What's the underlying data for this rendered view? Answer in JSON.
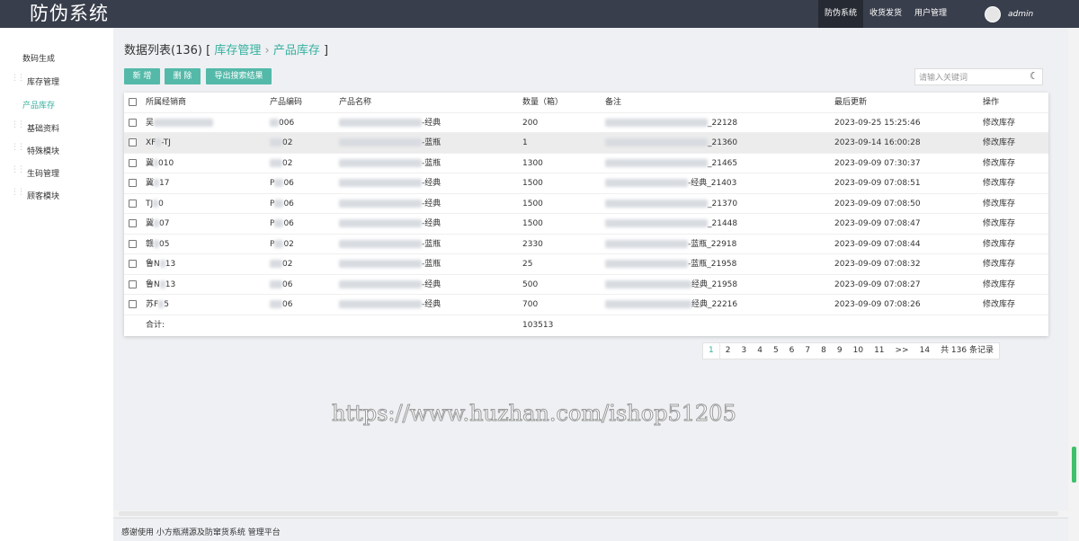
{
  "app": {
    "title": "防伪系统"
  },
  "topnav": [
    {
      "label": "防伪系统",
      "active": true
    },
    {
      "label": "收货发货",
      "active": false
    },
    {
      "label": "用户管理",
      "active": false
    }
  ],
  "user": {
    "name": "admin"
  },
  "sidebar": {
    "items": [
      {
        "label": "数码生成",
        "active": false,
        "grip": false
      },
      {
        "label": "库存管理",
        "active": false,
        "grip": true
      },
      {
        "label": "产品库存",
        "active": true,
        "grip": false
      },
      {
        "label": "基础资料",
        "active": false,
        "grip": true
      },
      {
        "label": "特殊模块",
        "active": false,
        "grip": true
      },
      {
        "label": "生码管理",
        "active": false,
        "grip": true
      },
      {
        "label": "顾客模块",
        "active": false,
        "grip": true
      }
    ]
  },
  "page": {
    "title": "数据列表(136)",
    "bracket_open": "[",
    "bracket_close": "]",
    "breadcrumb": [
      "库存管理",
      "产品库存"
    ],
    "separator": "›"
  },
  "toolbar": {
    "add_label": "新 增",
    "delete_label": "删 除",
    "export_label": "导出搜索结果"
  },
  "search": {
    "placeholder": "请输入关键词",
    "icon": "refresh-search-icon"
  },
  "table": {
    "headers": [
      "所属经销商",
      "产品编码",
      "产品名称",
      "数量（箱）",
      "备注",
      "最后更新",
      "操作"
    ],
    "rows": [
      {
        "dealer": "吴",
        "code": "0",
        "code_suffix": "06",
        "name": "-经典",
        "qty": "200",
        "note": "_22128",
        "updated": "2023-09-25 15:25:46",
        "action": "修改库存"
      },
      {
        "dealer": "XF",
        "dealer_suffix": "-TJ",
        "code": "",
        "code_suffix": "02",
        "name": "-蓝瓶",
        "qty": "1",
        "note": "_21360",
        "updated": "2023-09-14 16:00:28",
        "action": "修改库存"
      },
      {
        "dealer": "冀",
        "dealer_suffix": "010",
        "code": "",
        "code_suffix": "02",
        "name": "-蓝瓶",
        "qty": "1300",
        "note": "_21465",
        "updated": "2023-09-09 07:30:37",
        "action": "修改库存"
      },
      {
        "dealer": "冀",
        "dealer_suffix": "17",
        "code": "P",
        "code_suffix": "06",
        "name": "-经典",
        "qty": "1500",
        "note": "-经典_21403",
        "updated": "2023-09-09 07:08:51",
        "action": "修改库存"
      },
      {
        "dealer": "TJ",
        "dealer_suffix": "0",
        "code": "P",
        "code_suffix": "06",
        "name": "-经典",
        "qty": "1500",
        "note": "_21370",
        "updated": "2023-09-09 07:08:50",
        "action": "修改库存"
      },
      {
        "dealer": "冀",
        "dealer_suffix": "07",
        "code": "P",
        "code_suffix": "06",
        "name": "-经典",
        "qty": "1500",
        "note": "_21448",
        "updated": "2023-09-09 07:08:47",
        "action": "修改库存"
      },
      {
        "dealer": "赣",
        "dealer_suffix": "05",
        "code": "P",
        "code_suffix": "02",
        "name": "-蓝瓶",
        "qty": "2330",
        "note": "-蓝瓶_22918",
        "updated": "2023-09-09 07:08:44",
        "action": "修改库存"
      },
      {
        "dealer": "鲁N",
        "dealer_suffix": "13",
        "code": "",
        "code_suffix": "02",
        "name": "-蓝瓶",
        "qty": "25",
        "note": "-蓝瓶_21958",
        "updated": "2023-09-09 07:08:32",
        "action": "修改库存"
      },
      {
        "dealer": "鲁N",
        "dealer_suffix": "13",
        "code": "",
        "code_suffix": "06",
        "name": "-经典",
        "qty": "500",
        "note": "经典_21958",
        "updated": "2023-09-09 07:08:27",
        "action": "修改库存"
      },
      {
        "dealer": "苏F",
        "dealer_suffix": "5",
        "code": "",
        "code_suffix": "06",
        "name": "-经典",
        "qty": "700",
        "note": "经典_22216",
        "updated": "2023-09-09 07:08:26",
        "action": "修改库存"
      }
    ],
    "total_label": "合计:",
    "total_qty": "103513"
  },
  "pagination": {
    "pages": [
      "1",
      "2",
      "3",
      "4",
      "5",
      "6",
      "7",
      "8",
      "9",
      "10",
      "11",
      ">>",
      "14"
    ],
    "current": "1",
    "total_text": "共 136 条记录"
  },
  "watermark": "https://www.huzhan.com/ishop51205",
  "footer": {
    "text": "感谢使用 小方瓶溯源及防窜货系统 管理平台"
  },
  "colors": {
    "accent": "#36b09f",
    "topbar": "#383e4b",
    "button": "#54b9a9"
  }
}
